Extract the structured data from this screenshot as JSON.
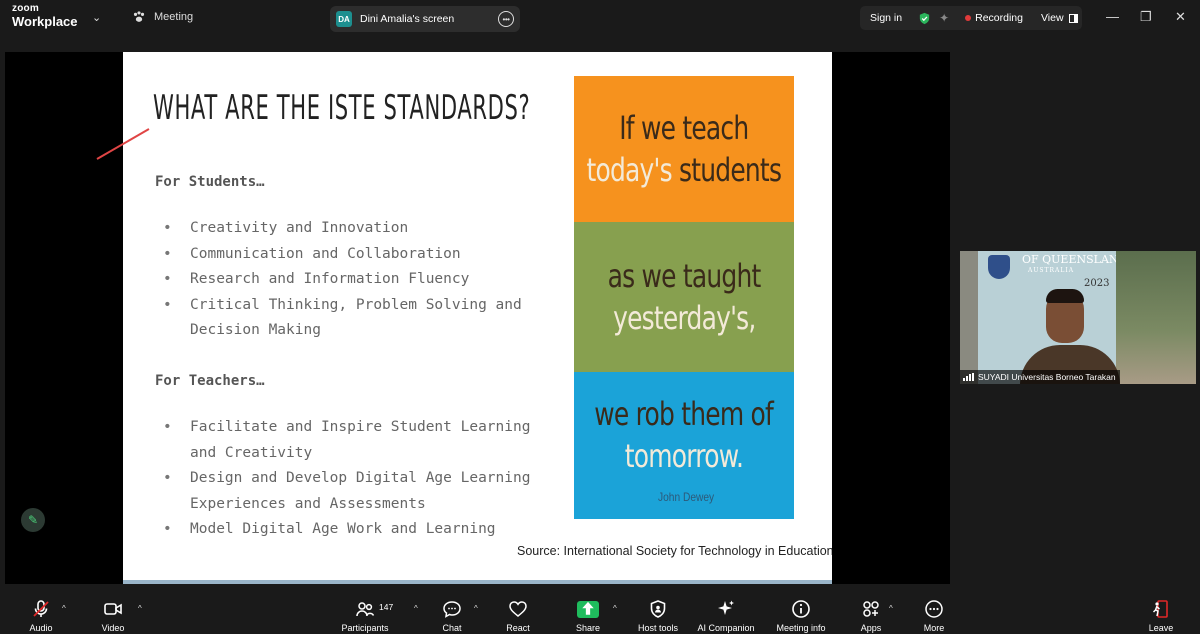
{
  "window": {
    "logo_line1": "zoom",
    "logo_line2": "Workplace",
    "meeting_tab": "Meeting",
    "share_tab": {
      "badge": "DA",
      "label": "Dini Amalia's screen",
      "more": "•••"
    },
    "sign_in": "Sign in",
    "recording": "Recording",
    "view": "View"
  },
  "slide": {
    "title": "WHAT ARE THE ISTE STANDARDS?",
    "students_heading": "For Students…",
    "students": [
      "Creativity and Innovation",
      "Communication and Collaboration",
      "Research and Information Fluency",
      "Critical Thinking, Problem Solving and",
      "Decision Making"
    ],
    "teachers_heading": "For Teachers…",
    "teachers": [
      "Facilitate and Inspire Student Learning",
      "and Creativity",
      "Design and Develop Digital Age Learning",
      "Experiences and Assessments",
      "Model Digital Age Work and Learning"
    ],
    "source": "Source: International Society for Technology in Education",
    "poster": {
      "line1": "If we teach",
      "line2a": "today's",
      "line2b": " students",
      "line3": "as we taught",
      "line4": "yesterday's,",
      "line5": "we rob them of",
      "line6": "tomorrow.",
      "author": "John Dewey"
    }
  },
  "participant": {
    "banner": "OF QUEENSLAN",
    "banner_sub": "AUSTRALIA",
    "year": "2023",
    "name": "SUYADI Universitas Borneo Tarakan"
  },
  "toolbar": {
    "audio": "Audio",
    "video": "Video",
    "participants": "Participants",
    "participants_count": "147",
    "chat": "Chat",
    "react": "React",
    "share": "Share",
    "host_tools": "Host tools",
    "ai_companion": "AI Companion",
    "meeting_info": "Meeting info",
    "apps": "Apps",
    "more": "More",
    "leave": "Leave"
  },
  "colors": {
    "record_dot": "#e03a3a",
    "share_green": "#1fbc5d",
    "poster_orange": "#f6921e",
    "poster_green": "#87a04f",
    "poster_blue": "#1ba3d8",
    "leave_red": "#e02828"
  },
  "icons": [
    "paw-icon",
    "more-icon",
    "shield-check-icon",
    "sparkle-icon",
    "view-icon",
    "minimize-icon",
    "restore-icon",
    "close-icon",
    "pencil-icon",
    "signal-icon",
    "mic-muted-icon",
    "camera-icon",
    "participants-icon",
    "chat-icon",
    "heart-icon",
    "share-arrow-icon",
    "shield-icon",
    "ai-sparkle-icon",
    "info-icon",
    "apps-icon",
    "more-dots-icon",
    "leave-icon"
  ]
}
